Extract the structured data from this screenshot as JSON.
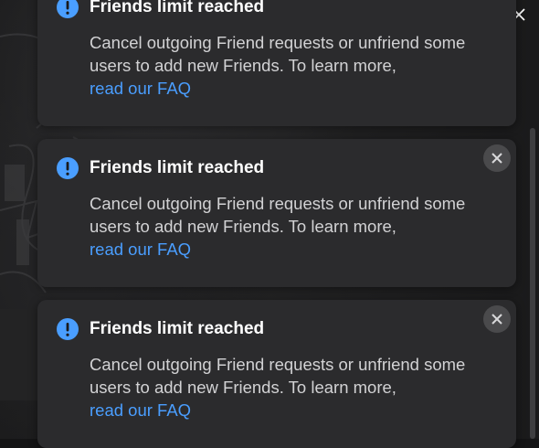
{
  "window": {
    "minimize_icon": "minimize-icon",
    "restore_icon": "restore-icon",
    "close_icon": "close-icon"
  },
  "toasts": [
    {
      "title": "Friends limit reached",
      "body": "Cancel outgoing Friend requests or unfriend some users to add new Friends. To learn more,",
      "link": "read our FAQ",
      "has_close": false
    },
    {
      "title": "Friends limit reached",
      "body": "Cancel outgoing Friend requests or unfriend some users to add new Friends. To learn more,",
      "link": "read our FAQ",
      "has_close": true
    },
    {
      "title": "Friends limit reached",
      "body": "Cancel outgoing Friend requests or unfriend some users to add new Friends. To learn more,",
      "link": "read our FAQ",
      "has_close": true
    }
  ],
  "colors": {
    "toast_bg": "#2b2b2d",
    "info_icon": "#4a9eff",
    "link": "#4a9eff",
    "close_bg": "#4a4a4c"
  }
}
